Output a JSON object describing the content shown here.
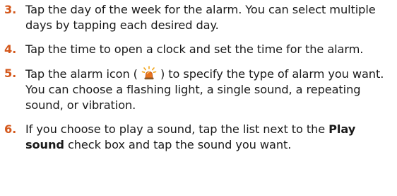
{
  "steps": [
    {
      "number": "3.",
      "text": "Tap the day of the week for the alarm. You can select multiple days by tapping each desired day."
    },
    {
      "number": "4.",
      "text": "Tap the time to open a clock and set the time for the alarm."
    },
    {
      "number": "5.",
      "text_before_icon": "Tap the alarm icon ( ",
      "icon": "alarm-icon",
      "text_after_icon": " ) to specify the type of alarm you want. You can choose a flashing light, a single sound, a repeating sound, or vibration."
    },
    {
      "number": "6.",
      "text_part1": "If you choose to play a sound, tap the list next to the ",
      "bold1": "Play sound",
      "text_part2": " check box and tap the sound you want."
    }
  ],
  "colors": {
    "step_number": "#d4581c",
    "text": "#1a1a1a"
  }
}
